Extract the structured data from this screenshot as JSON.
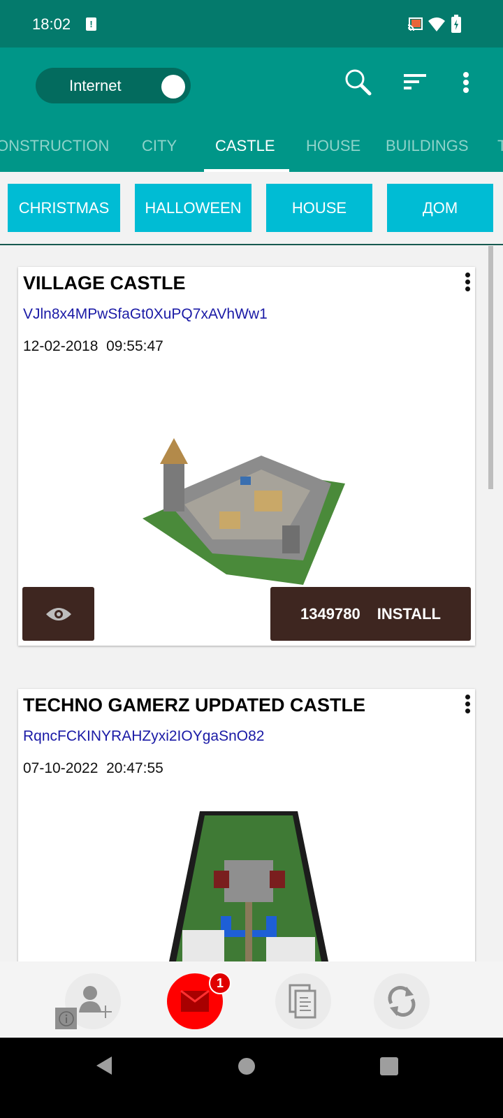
{
  "status_bar": {
    "time": "18:02",
    "icons": [
      "sim-alert-icon",
      "cast-icon",
      "wifi-icon",
      "battery-charging-icon"
    ]
  },
  "app_bar": {
    "toggle_label": "Internet",
    "toggle_on": true,
    "actions": [
      "search-icon",
      "sort-icon",
      "more-vert-icon"
    ]
  },
  "tabs": [
    {
      "label": "ONSTRUCTION"
    },
    {
      "label": "CITY"
    },
    {
      "label": "CASTLE",
      "active": true
    },
    {
      "label": "HOUSE"
    },
    {
      "label": "BUILDINGS"
    },
    {
      "label": "T"
    }
  ],
  "chips": [
    "CHRISTMAS",
    "HALLOWEEN",
    "HOUSE",
    "ДОМ"
  ],
  "cards": [
    {
      "title": "VILLAGE CASTLE",
      "code": "VJln8x4MPwSfaGt0XuPQ7xAVhWw1",
      "date": "12-02-2018  09:55:47",
      "count": "1349780",
      "install_label": "INSTALL"
    },
    {
      "title": "TECHNO GAMERZ UPDATED CASTLE",
      "code": "RqncFCKINYRAHZyxi2IOYgaSnO82",
      "date": "07-10-2022  20:47:55"
    }
  ],
  "bottom_bar": {
    "mail_badge": "1",
    "buttons": [
      "add-user-icon",
      "mail-icon",
      "copy-icon",
      "refresh-icon"
    ]
  },
  "colors": {
    "status": "#047a6c",
    "primary": "#009688",
    "chip": "#00bcd4",
    "button": "#3e2620",
    "mail": "#ff0000"
  }
}
